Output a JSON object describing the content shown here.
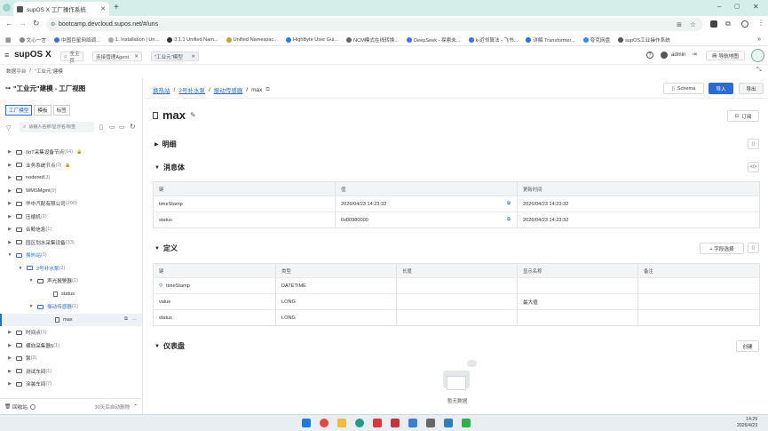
{
  "browser": {
    "tab_title": "supOS X 工厂操作系统",
    "url": "bootcamp.devcloud.supos.net/#/uns",
    "bookmarks": [
      "文心一言",
      "中国巨星网络调...",
      "1. Installation | Un...",
      "3.1.1 Unified Nam...",
      "Unified Namespac...",
      "HighByte User Gui...",
      "NCM模式在线转换...",
      "DeepSeek - 探索未...",
      "k-近邻算法 - 飞书...",
      "详解 Transformer...",
      "夸克网盘",
      "supOS工业操作系统"
    ]
  },
  "app": {
    "logo": "supOS X",
    "tabs": [
      "全主页",
      "连接管理Agent",
      "\"工业元\"模型"
    ],
    "user": "admin",
    "nav_map": "导航地图",
    "breadcrumb_root": "数据平台",
    "breadcrumb_current": "\"工业元\"建模"
  },
  "sidebar": {
    "title": "\"工业元\"建模 - 工厂视图",
    "view_tabs": [
      "工厂模型",
      "模板",
      "标签"
    ],
    "search_placeholder": "请输入名称/显示名/标签",
    "tree": [
      {
        "label": "IIoT采集设备节点",
        "count": "(64)",
        "level": 1,
        "type": "folder",
        "lock": true
      },
      {
        "label": "业务系统节点",
        "count": "(0)",
        "level": 1,
        "type": "folder",
        "lock": true
      },
      {
        "label": "nodered",
        "count": "(3)",
        "level": 1,
        "type": "folder"
      },
      {
        "label": "WMSMgmt",
        "count": "(9)",
        "level": 1,
        "type": "folder"
      },
      {
        "label": "华中汽配有限公司",
        "count": "(200)",
        "level": 1,
        "type": "folder"
      },
      {
        "label": "压缩机",
        "count": "(1)",
        "level": 1,
        "type": "folder"
      },
      {
        "label": "合鲸信息",
        "count": "(1)",
        "level": 1,
        "type": "folder"
      },
      {
        "label": "园区划水采集设备",
        "count": "(33)",
        "level": 1,
        "type": "folder"
      },
      {
        "label": "换热站",
        "count": "(3)",
        "level": 1,
        "type": "folder",
        "open": true,
        "blue": true
      },
      {
        "label": "2号补水泵",
        "count": "(2)",
        "level": 2,
        "type": "folder",
        "open": true,
        "blue": true
      },
      {
        "label": "声光报警器",
        "count": "(1)",
        "level": 3,
        "type": "folder",
        "open": true
      },
      {
        "label": "status",
        "count": "",
        "level": 4,
        "type": "file"
      },
      {
        "label": "振动传感器",
        "count": "(1)",
        "level": 3,
        "type": "folder",
        "open": true,
        "blue": true
      },
      {
        "label": "max",
        "count": "",
        "level": 4,
        "type": "file",
        "selected": true
      },
      {
        "label": "时间点",
        "count": "(1)",
        "level": 1,
        "type": "folder"
      },
      {
        "label": "横向采集器5",
        "count": "(1)",
        "level": 1,
        "type": "folder"
      },
      {
        "label": "泵",
        "count": "(3)",
        "level": 1,
        "type": "folder"
      },
      {
        "label": "测试车间",
        "count": "(1)",
        "level": 1,
        "type": "folder"
      },
      {
        "label": "涂装车间",
        "count": "(7)",
        "level": 1,
        "type": "folder"
      }
    ],
    "recycle_bin": "回收站",
    "auto_delete": "30天后自动删除"
  },
  "main": {
    "breadcrumb": [
      "换热站",
      "2号补水泵",
      "振动传感器",
      "max"
    ],
    "schema_button": "Schema",
    "import_button": "导入",
    "export_button": "导出",
    "title": "max",
    "subscribe_button": "订阅",
    "detail_section": "明细",
    "message_section": "消息体",
    "message_columns": [
      "键",
      "值",
      "更新时间"
    ],
    "message_rows": [
      {
        "key": "timeStamp",
        "value": "2026/04/23 14:23:32",
        "time": "2026/04/23 14:23:32"
      },
      {
        "key": "status",
        "value": "0x80980000",
        "time": "2026/04/23 14:23:32"
      }
    ],
    "definition_section": "定义",
    "field_select_button": "+ 字段选择",
    "definition_columns": [
      "键",
      "类型",
      "长度",
      "显示名称",
      "备注"
    ],
    "definition_rows": [
      {
        "key": "timeStamp",
        "type": "DATETIME",
        "length": "",
        "display": "",
        "note": ""
      },
      {
        "key": "value",
        "type": "LONG",
        "length": "",
        "display": "最大值",
        "note": ""
      },
      {
        "key": "status",
        "type": "LONG",
        "length": "",
        "display": "",
        "note": ""
      }
    ],
    "dashboard_section": "仪表盘",
    "create_button": "创建",
    "empty_text": "暂无数据"
  },
  "taskbar": {
    "time": "14:29",
    "date": "2026/4/23"
  }
}
